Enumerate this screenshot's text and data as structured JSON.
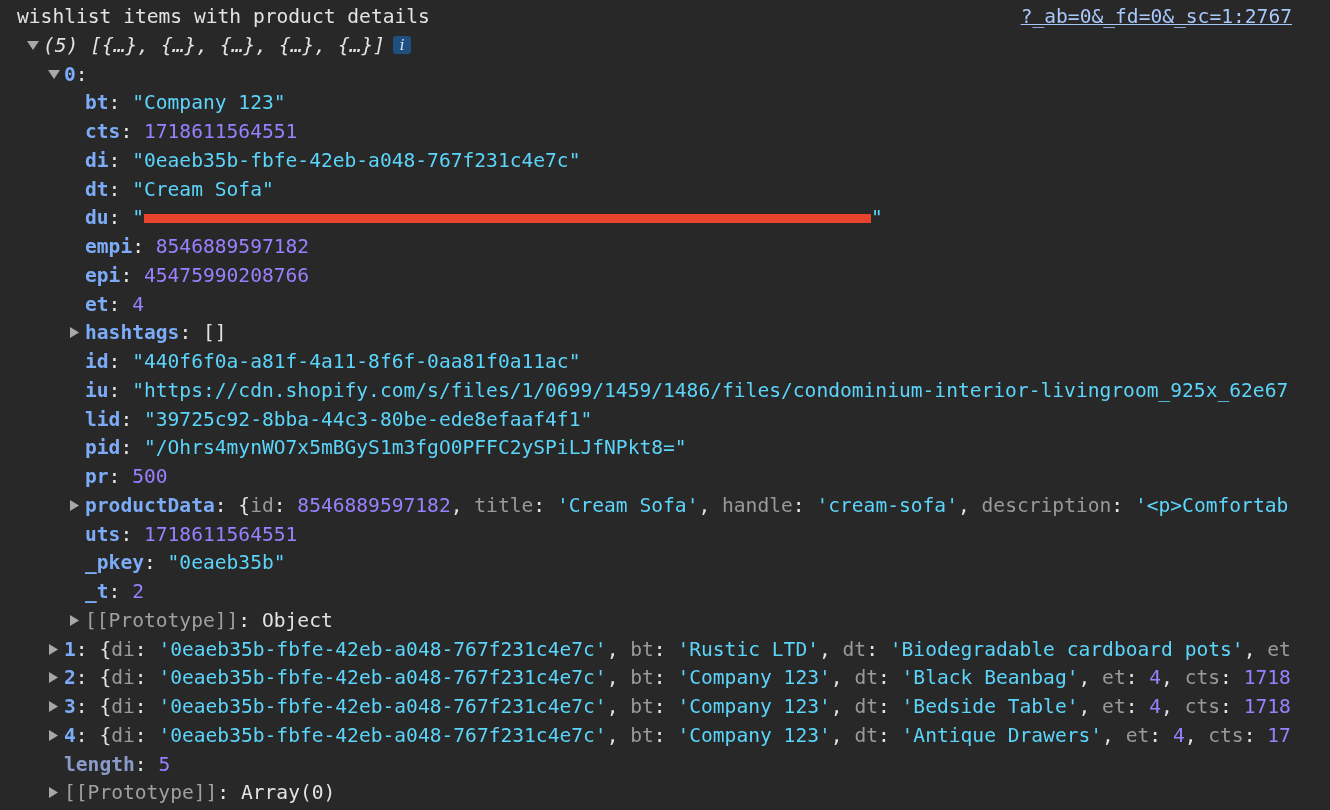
{
  "message": {
    "text": "wishlist items with product details",
    "source": "?_ab=0&_fd=0&_sc=1:2767"
  },
  "root": {
    "expanded": true,
    "value": [
      {
        "kind": "italic",
        "text": "(5) [{…}, {…}, {…}, {…}, {…}]"
      }
    ],
    "info": "i",
    "children": [
      {
        "key": "0",
        "kind": "own",
        "expanded": true,
        "value": [
          {
            "kind": "punct",
            "text": ":"
          }
        ],
        "children": [
          {
            "key": "bt",
            "kind": "own",
            "value": [
              {
                "kind": "punct",
                "text": ": "
              },
              {
                "kind": "string",
                "text": "\"Company 123\""
              }
            ]
          },
          {
            "key": "cts",
            "kind": "own",
            "value": [
              {
                "kind": "punct",
                "text": ": "
              },
              {
                "kind": "number",
                "text": "1718611564551"
              }
            ]
          },
          {
            "key": "di",
            "kind": "own",
            "value": [
              {
                "kind": "punct",
                "text": ": "
              },
              {
                "kind": "string",
                "text": "\"0eaeb35b-fbfe-42eb-a048-767f231c4e7c\""
              }
            ]
          },
          {
            "key": "dt",
            "kind": "own",
            "value": [
              {
                "kind": "punct",
                "text": ": "
              },
              {
                "kind": "string",
                "text": "\"Cream Sofa\""
              }
            ]
          },
          {
            "key": "du",
            "kind": "own",
            "value": [
              {
                "kind": "punct",
                "text": ": "
              },
              {
                "kind": "string",
                "text": "\""
              },
              {
                "kind": "redaction"
              },
              {
                "kind": "string",
                "text": "\""
              }
            ]
          },
          {
            "key": "empi",
            "kind": "own",
            "value": [
              {
                "kind": "punct",
                "text": ": "
              },
              {
                "kind": "number",
                "text": "8546889597182"
              }
            ]
          },
          {
            "key": "epi",
            "kind": "own",
            "value": [
              {
                "kind": "punct",
                "text": ": "
              },
              {
                "kind": "number",
                "text": "45475990208766"
              }
            ]
          },
          {
            "key": "et",
            "kind": "own",
            "value": [
              {
                "kind": "punct",
                "text": ": "
              },
              {
                "kind": "number",
                "text": "4"
              }
            ]
          },
          {
            "key": "hashtags",
            "kind": "own",
            "expanded": false,
            "value": [
              {
                "kind": "punct",
                "text": ": []"
              }
            ]
          },
          {
            "key": "id",
            "kind": "own",
            "value": [
              {
                "kind": "punct",
                "text": ": "
              },
              {
                "kind": "string",
                "text": "\"440f6f0a-a81f-4a11-8f6f-0aa81f0a11ac\""
              }
            ]
          },
          {
            "key": "iu",
            "kind": "own",
            "value": [
              {
                "kind": "punct",
                "text": ": "
              },
              {
                "kind": "string",
                "text": "\"https://cdn.shopify.com/s/files/1/0699/1459/1486/files/condominium-interior-livingroom_925x_62e67"
              }
            ]
          },
          {
            "key": "lid",
            "kind": "own",
            "value": [
              {
                "kind": "punct",
                "text": ": "
              },
              {
                "kind": "string",
                "text": "\"39725c92-8bba-44c3-80be-ede8efaaf4f1\""
              }
            ]
          },
          {
            "key": "pid",
            "kind": "own",
            "value": [
              {
                "kind": "punct",
                "text": ": "
              },
              {
                "kind": "string",
                "text": "\"/Ohrs4mynWO7x5mBGyS1m3fgO0PFFC2ySPiLJfNPkt8=\""
              }
            ]
          },
          {
            "key": "pr",
            "kind": "own",
            "value": [
              {
                "kind": "punct",
                "text": ": "
              },
              {
                "kind": "number",
                "text": "500"
              }
            ]
          },
          {
            "key": "productData",
            "kind": "own",
            "expanded": false,
            "value": [
              {
                "kind": "punct",
                "text": ": {"
              },
              {
                "kind": "preview_key",
                "text": "id"
              },
              {
                "kind": "punct",
                "text": ": "
              },
              {
                "kind": "number",
                "text": "8546889597182"
              },
              {
                "kind": "punct",
                "text": ", "
              },
              {
                "kind": "preview_key",
                "text": "title"
              },
              {
                "kind": "punct",
                "text": ": "
              },
              {
                "kind": "string",
                "text": "'Cream Sofa'"
              },
              {
                "kind": "punct",
                "text": ", "
              },
              {
                "kind": "preview_key",
                "text": "handle"
              },
              {
                "kind": "punct",
                "text": ": "
              },
              {
                "kind": "string",
                "text": "'cream-sofa'"
              },
              {
                "kind": "punct",
                "text": ", "
              },
              {
                "kind": "preview_key",
                "text": "description"
              },
              {
                "kind": "punct",
                "text": ": "
              },
              {
                "kind": "string",
                "text": "'<p>Comfortab"
              }
            ]
          },
          {
            "key": "uts",
            "kind": "own",
            "value": [
              {
                "kind": "punct",
                "text": ": "
              },
              {
                "kind": "number",
                "text": "1718611564551"
              }
            ]
          },
          {
            "key": "_pkey",
            "kind": "own",
            "value": [
              {
                "kind": "punct",
                "text": ": "
              },
              {
                "kind": "string",
                "text": "\"0eaeb35b\""
              }
            ]
          },
          {
            "key": "_t",
            "kind": "own",
            "value": [
              {
                "kind": "punct",
                "text": ": "
              },
              {
                "kind": "number",
                "text": "2"
              }
            ]
          },
          {
            "key": "[[Prototype]]",
            "kind": "internal",
            "expanded": false,
            "value": [
              {
                "kind": "punct",
                "text": ": Object"
              }
            ]
          }
        ]
      },
      {
        "key": "1",
        "kind": "own",
        "expanded": false,
        "value": [
          {
            "kind": "punct",
            "text": ": {"
          },
          {
            "kind": "preview_key",
            "text": "di"
          },
          {
            "kind": "punct",
            "text": ": "
          },
          {
            "kind": "string",
            "text": "'0eaeb35b-fbfe-42eb-a048-767f231c4e7c'"
          },
          {
            "kind": "punct",
            "text": ", "
          },
          {
            "kind": "preview_key",
            "text": "bt"
          },
          {
            "kind": "punct",
            "text": ": "
          },
          {
            "kind": "string",
            "text": "'Rustic LTD'"
          },
          {
            "kind": "punct",
            "text": ", "
          },
          {
            "kind": "preview_key",
            "text": "dt"
          },
          {
            "kind": "punct",
            "text": ": "
          },
          {
            "kind": "string",
            "text": "'Biodegradable cardboard pots'"
          },
          {
            "kind": "punct",
            "text": ", "
          },
          {
            "kind": "preview_key",
            "text": "et"
          }
        ]
      },
      {
        "key": "2",
        "kind": "own",
        "expanded": false,
        "value": [
          {
            "kind": "punct",
            "text": ": {"
          },
          {
            "kind": "preview_key",
            "text": "di"
          },
          {
            "kind": "punct",
            "text": ": "
          },
          {
            "kind": "string",
            "text": "'0eaeb35b-fbfe-42eb-a048-767f231c4e7c'"
          },
          {
            "kind": "punct",
            "text": ", "
          },
          {
            "kind": "preview_key",
            "text": "bt"
          },
          {
            "kind": "punct",
            "text": ": "
          },
          {
            "kind": "string",
            "text": "'Company 123'"
          },
          {
            "kind": "punct",
            "text": ", "
          },
          {
            "kind": "preview_key",
            "text": "dt"
          },
          {
            "kind": "punct",
            "text": ": "
          },
          {
            "kind": "string",
            "text": "'Black Beanbag'"
          },
          {
            "kind": "punct",
            "text": ", "
          },
          {
            "kind": "preview_key",
            "text": "et"
          },
          {
            "kind": "punct",
            "text": ": "
          },
          {
            "kind": "number",
            "text": "4"
          },
          {
            "kind": "punct",
            "text": ", "
          },
          {
            "kind": "preview_key",
            "text": "cts"
          },
          {
            "kind": "punct",
            "text": ": "
          },
          {
            "kind": "number",
            "text": "1718"
          }
        ]
      },
      {
        "key": "3",
        "kind": "own",
        "expanded": false,
        "value": [
          {
            "kind": "punct",
            "text": ": {"
          },
          {
            "kind": "preview_key",
            "text": "di"
          },
          {
            "kind": "punct",
            "text": ": "
          },
          {
            "kind": "string",
            "text": "'0eaeb35b-fbfe-42eb-a048-767f231c4e7c'"
          },
          {
            "kind": "punct",
            "text": ", "
          },
          {
            "kind": "preview_key",
            "text": "bt"
          },
          {
            "kind": "punct",
            "text": ": "
          },
          {
            "kind": "string",
            "text": "'Company 123'"
          },
          {
            "kind": "punct",
            "text": ", "
          },
          {
            "kind": "preview_key",
            "text": "dt"
          },
          {
            "kind": "punct",
            "text": ": "
          },
          {
            "kind": "string",
            "text": "'Bedside Table'"
          },
          {
            "kind": "punct",
            "text": ", "
          },
          {
            "kind": "preview_key",
            "text": "et"
          },
          {
            "kind": "punct",
            "text": ": "
          },
          {
            "kind": "number",
            "text": "4"
          },
          {
            "kind": "punct",
            "text": ", "
          },
          {
            "kind": "preview_key",
            "text": "cts"
          },
          {
            "kind": "punct",
            "text": ": "
          },
          {
            "kind": "number",
            "text": "1718"
          }
        ]
      },
      {
        "key": "4",
        "kind": "own",
        "expanded": false,
        "value": [
          {
            "kind": "punct",
            "text": ": {"
          },
          {
            "kind": "preview_key",
            "text": "di"
          },
          {
            "kind": "punct",
            "text": ": "
          },
          {
            "kind": "string",
            "text": "'0eaeb35b-fbfe-42eb-a048-767f231c4e7c'"
          },
          {
            "kind": "punct",
            "text": ", "
          },
          {
            "kind": "preview_key",
            "text": "bt"
          },
          {
            "kind": "punct",
            "text": ": "
          },
          {
            "kind": "string",
            "text": "'Company 123'"
          },
          {
            "kind": "punct",
            "text": ", "
          },
          {
            "kind": "preview_key",
            "text": "dt"
          },
          {
            "kind": "punct",
            "text": ": "
          },
          {
            "kind": "string",
            "text": "'Antique Drawers'"
          },
          {
            "kind": "punct",
            "text": ", "
          },
          {
            "kind": "preview_key",
            "text": "et"
          },
          {
            "kind": "punct",
            "text": ": "
          },
          {
            "kind": "number",
            "text": "4"
          },
          {
            "kind": "punct",
            "text": ", "
          },
          {
            "kind": "preview_key",
            "text": "cts"
          },
          {
            "kind": "punct",
            "text": ": "
          },
          {
            "kind": "number",
            "text": "17"
          }
        ]
      },
      {
        "key": "length",
        "kind": "non_enumerable",
        "value": [
          {
            "kind": "punct",
            "text": ": "
          },
          {
            "kind": "number",
            "text": "5"
          }
        ]
      },
      {
        "key": "[[Prototype]]",
        "kind": "internal",
        "expanded": false,
        "value": [
          {
            "kind": "punct",
            "text": ": Array(0)"
          }
        ]
      }
    ]
  }
}
